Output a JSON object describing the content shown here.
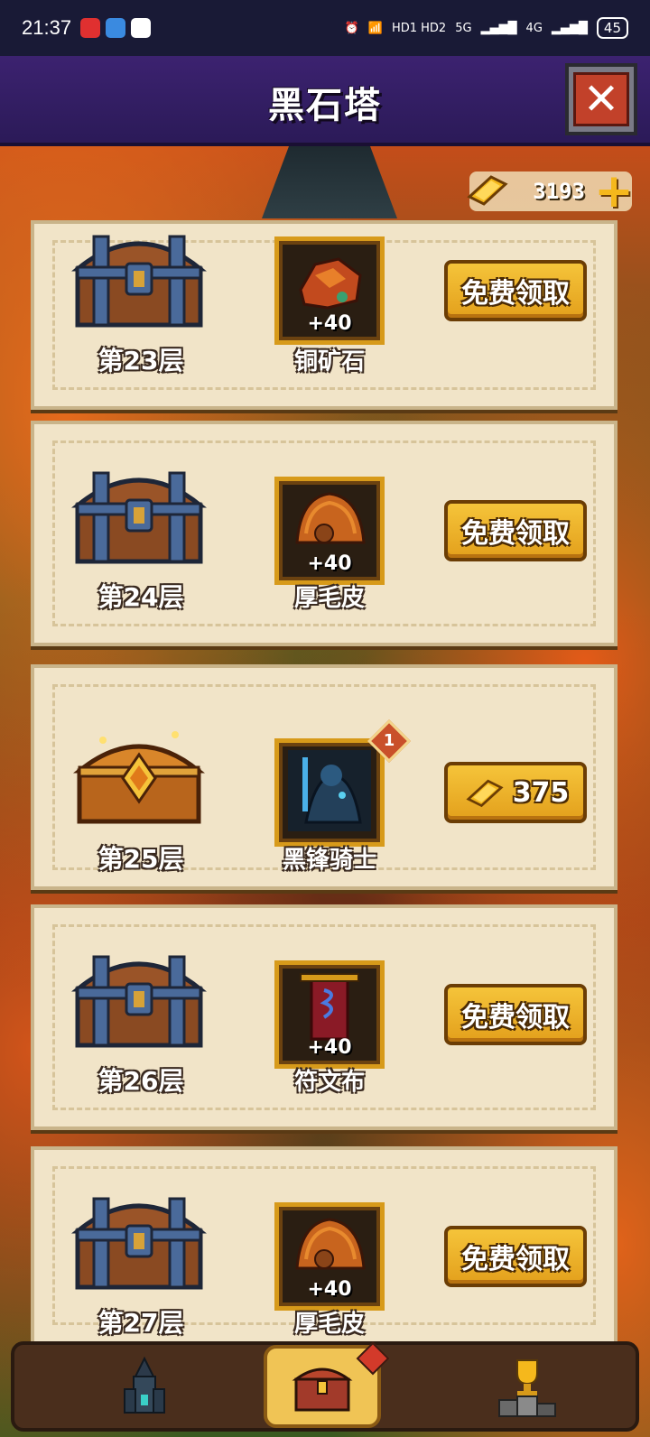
{
  "status_bar": {
    "time": "21:37",
    "network_label": "HD1 HD2",
    "signal_5g": "5G",
    "signal_4g": "4G",
    "battery": "45"
  },
  "header": {
    "title": "黑石塔",
    "close_icon": "close-x-icon"
  },
  "currency": {
    "gold_amount": "3193",
    "add_icon": "plus-icon"
  },
  "rewards": [
    {
      "floor": "第23层",
      "item_name": "铜矿石",
      "qty": "+40",
      "button_type": "free",
      "button_label": "免费领取",
      "chest": "iron-chest"
    },
    {
      "floor": "第24层",
      "item_name": "厚毛皮",
      "qty": "+40",
      "button_type": "free",
      "button_label": "免费领取",
      "chest": "iron-chest"
    },
    {
      "floor": "第25层",
      "item_name": "黑锋骑士",
      "qty": "",
      "badge": "1",
      "button_type": "gold",
      "button_label": "375",
      "chest": "golden-chest"
    },
    {
      "floor": "第26层",
      "item_name": "符文布",
      "qty": "+40",
      "button_type": "free",
      "button_label": "免费领取",
      "chest": "iron-chest"
    },
    {
      "floor": "第27层",
      "item_name": "厚毛皮",
      "qty": "+40",
      "button_type": "free",
      "button_label": "免费领取",
      "chest": "iron-chest"
    }
  ],
  "bottom_nav": [
    {
      "name": "tower",
      "icon": "tower-icon"
    },
    {
      "name": "chest",
      "icon": "treasure-chest-icon",
      "active": true
    },
    {
      "name": "ranking",
      "icon": "trophy-podium-icon"
    }
  ],
  "colors": {
    "header_bg": "#3c2270",
    "card_bg": "#f1e4c8",
    "gold_button": "#f5c43a",
    "item_border": "#d79a1a"
  }
}
